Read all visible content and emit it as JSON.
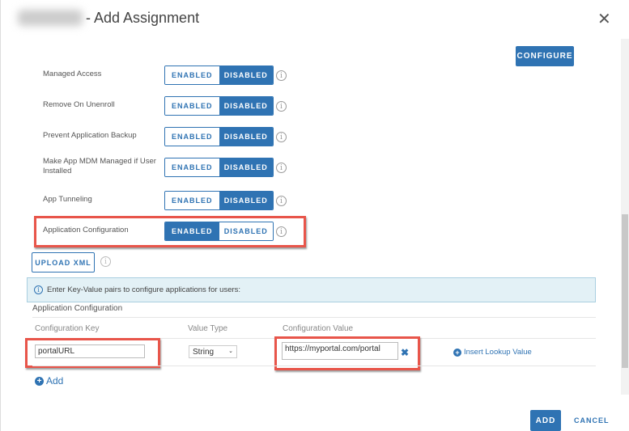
{
  "header": {
    "title": "- Add Assignment",
    "close_icon": "close-icon"
  },
  "configure_label": "CONFIGURE",
  "settings": [
    {
      "label": "Managed Access",
      "enabled": "ENABLED",
      "disabled": "DISABLED",
      "state": "disabled"
    },
    {
      "label": "Remove On Unenroll",
      "enabled": "ENABLED",
      "disabled": "DISABLED",
      "state": "disabled"
    },
    {
      "label": "Prevent Application Backup",
      "enabled": "ENABLED",
      "disabled": "DISABLED",
      "state": "disabled"
    },
    {
      "label": "Make App MDM Managed if User Installed",
      "enabled": "ENABLED",
      "disabled": "DISABLED",
      "state": "disabled"
    },
    {
      "label": "App Tunneling",
      "enabled": "ENABLED",
      "disabled": "DISABLED",
      "state": "disabled"
    },
    {
      "label": "Application Configuration",
      "enabled": "ENABLED",
      "disabled": "DISABLED",
      "state": "enabled"
    }
  ],
  "upload_xml": "UPLOAD XML",
  "info_banner": "Enter Key-Value pairs to configure applications for users:",
  "section_title": "Application Configuration",
  "table": {
    "headers": [
      "Configuration Key",
      "Value Type",
      "Configuration Value"
    ],
    "row": {
      "key": "portalURL",
      "type": "String",
      "value": "https://myportal.com/portal",
      "lookup": "Insert Lookup Value"
    }
  },
  "add_label": "Add",
  "footer": {
    "add": "ADD",
    "cancel": "CANCEL"
  },
  "colors": {
    "accent": "#2f73b3",
    "highlight": "#e8554a",
    "banner": "#e3f1f6"
  }
}
